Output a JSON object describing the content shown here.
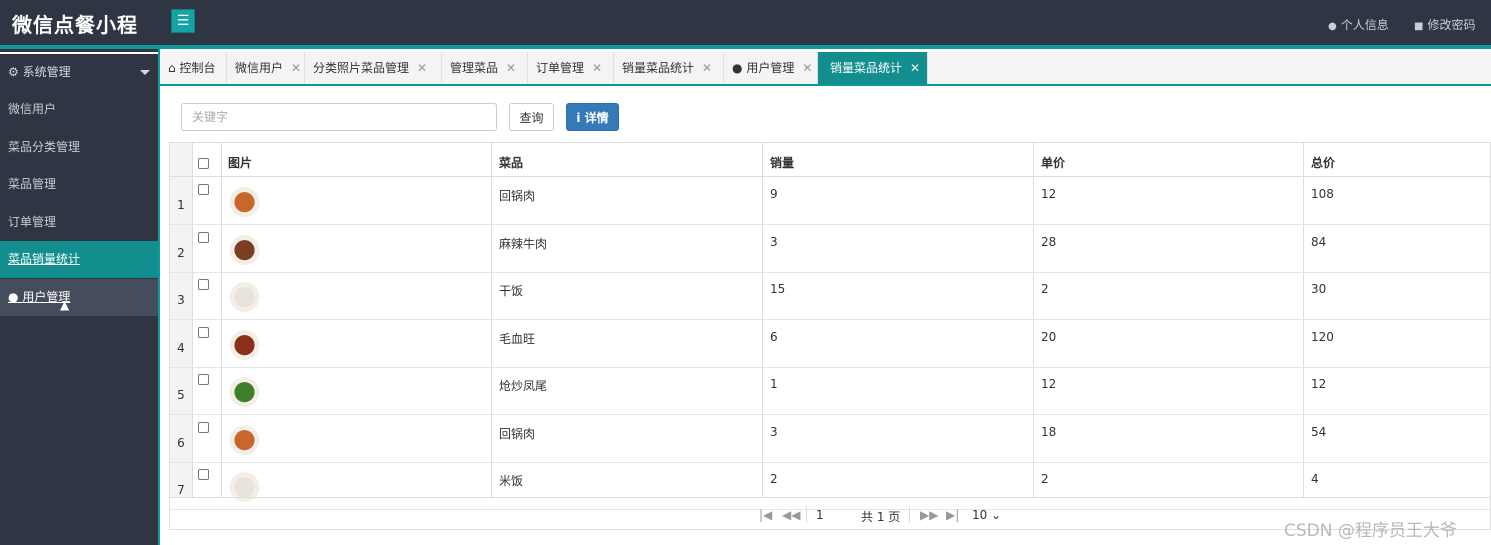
{
  "header": {
    "brand": "微信点餐小程",
    "menu_icon": "☰",
    "profile_label": "个人信息",
    "password_label": "修改密码"
  },
  "sidebar": {
    "section_label": "系统管理",
    "items": [
      {
        "label": "微信用户"
      },
      {
        "label": "菜品分类管理"
      },
      {
        "label": "菜品管理"
      },
      {
        "label": "订单管理"
      },
      {
        "label": "菜品销量统计"
      },
      {
        "label": "用户管理"
      }
    ]
  },
  "tabs": [
    {
      "label": "控制台"
    },
    {
      "label": "微信用户"
    },
    {
      "label": "分类照片菜品管理"
    },
    {
      "label": "管理菜品"
    },
    {
      "label": "订单管理"
    },
    {
      "label": "销量菜品统计"
    },
    {
      "label": "用户管理"
    },
    {
      "label": "销量菜品统计"
    }
  ],
  "toolbar": {
    "search_placeholder": "关键字",
    "query_label": "查询",
    "detail_label": "详情"
  },
  "table": {
    "columns": [
      "图片",
      "菜品",
      "销量",
      "单价",
      "总价"
    ],
    "rows": [
      {
        "num": "1",
        "dish": "回锅肉",
        "sales": "9",
        "price": "12",
        "total": "108",
        "thumb": "#c8662b"
      },
      {
        "num": "2",
        "dish": "麻辣牛肉",
        "sales": "3",
        "price": "28",
        "total": "84",
        "thumb": "#7a3f22"
      },
      {
        "num": "3",
        "dish": "干饭",
        "sales": "15",
        "price": "2",
        "total": "30",
        "thumb": "#e8e4dc"
      },
      {
        "num": "4",
        "dish": "毛血旺",
        "sales": "6",
        "price": "20",
        "total": "120",
        "thumb": "#8a2f1c"
      },
      {
        "num": "5",
        "dish": "炝炒凤尾",
        "sales": "1",
        "price": "12",
        "total": "12",
        "thumb": "#3f7f2a"
      },
      {
        "num": "6",
        "dish": "回锅肉",
        "sales": "3",
        "price": "18",
        "total": "54",
        "thumb": "#c8662b"
      },
      {
        "num": "7",
        "dish": "米饭",
        "sales": "2",
        "price": "2",
        "total": "4",
        "thumb": "#e8e4dc"
      }
    ]
  },
  "pager": {
    "page_value": "1",
    "total_text": "共 1 页",
    "page_size": "10"
  },
  "watermark": "CSDN @程序员王大爷",
  "colors": {
    "accent": "#128e8e",
    "header_bg": "#2f3542",
    "primary_button": "#337ab7"
  }
}
